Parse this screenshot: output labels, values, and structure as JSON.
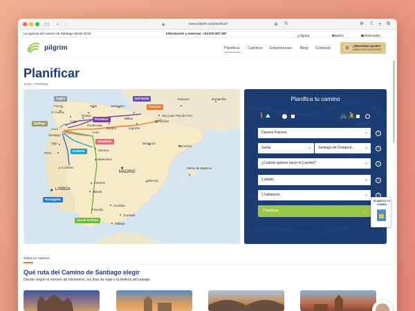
{
  "browser": {
    "url": "www.pilgrim.es/planificar/"
  },
  "topbar": {
    "left": "La agencia del camino de Santiago desde 2016",
    "phone": "Información y reservas: +34 910 607 497",
    "help": "¿Alguna duda?",
    "language": "Español",
    "pros": "Profesionales"
  },
  "header": {
    "logo": "pilgrim",
    "nav": [
      "Planificar",
      "Caminos",
      "Experiencias",
      "Blog",
      "Contacto"
    ],
    "help_title": "¿Necesitas ayuda?",
    "help_sub": "HABLA CON NOSOTROS"
  },
  "page": {
    "title": "Planificar",
    "breadcrumb_home": "Inicio",
    "breadcrumb_sep": ">",
    "breadcrumb_current": "Planificar"
  },
  "map": {
    "cities": [
      "Ferrol",
      "A Coruña",
      "Oviedo",
      "Gijón",
      "Santander",
      "Bilbao",
      "Toulouse",
      "Montpellier",
      "San Juan Pied de Port",
      "Ponferrada",
      "Lugo",
      "Burgos",
      "León",
      "Logroño",
      "Pamplona",
      "Santiago",
      "Vigo",
      "Porto",
      "Coimbra",
      "Zamora",
      "Salamanca",
      "Zaragoza",
      "Barcelona",
      "Cáceres",
      "Mérida",
      "Sevilla",
      "Córdoba",
      "Granada",
      "Málaga",
      "Valencia",
      "Palma de Mallorca"
    ],
    "capitals": [
      "MADRID",
      "LISBOA"
    ],
    "routes": [
      "Inglés",
      "Primitivo",
      "Del Norte",
      "Francés",
      "Epílogo",
      "Invierno",
      "Sanabrés",
      "Portugués",
      "Vía de la Plata"
    ],
    "colors": {
      "ingles": "#8f9aa3",
      "primitivo": "#7a3fa0",
      "norte": "#6a4fb0",
      "frances": "#f07a30",
      "epilogo": "#9a9a6a",
      "invierno": "#1ea3c8",
      "sanabres": "#e36a7a",
      "portugues": "#2a7ad0",
      "plata": "#6bb83a"
    }
  },
  "planner": {
    "title": "Planifica tu camino",
    "modes": [
      "walk",
      "bike"
    ],
    "camino": "Camino Francés",
    "from": "Sarria",
    "to": "Santiago de Compost...",
    "when": "¿Cuándo quieres hacer el Camino?",
    "adults": "1 adulto",
    "rooms": "1 habitación",
    "button": "Planificar",
    "button_arrow": "→"
  },
  "sidecard": {
    "text": "PLANIFICA TU CAMINO"
  },
  "section": {
    "label": "Todos los caminos",
    "title": "Qué ruta del Camino de Santiago elegir",
    "desc": "Decide según el número de kilómetros, los días de viaje o la belleza del paisaje."
  }
}
